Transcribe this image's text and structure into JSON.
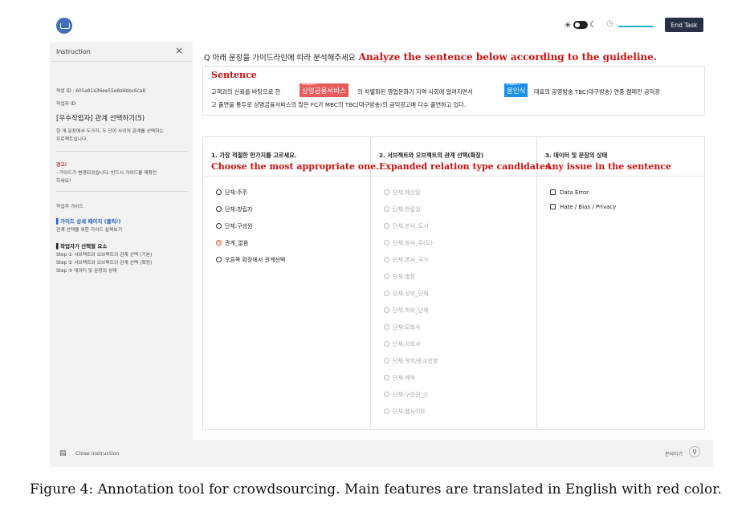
{
  "topbar": {
    "sun_icon": "sun-icon",
    "moon_icon": "moon-icon",
    "timer_icon": "timer-icon",
    "timer_color": "#18b4c8",
    "end_task": "End Task"
  },
  "sidebar": {
    "title": "Instruction",
    "close_glyph": "×",
    "task_id": "작업 ID : 605a91e36ee55e8d6bbc6ca8",
    "worker_id": "작업자 ID",
    "task_title": "[우수작업자] 관계 선택하기(5)",
    "desc_line1": "한 개 문장에서 두가지, 두 단어 사이의 관계를 선택하는",
    "desc_line2": "프로젝트입니다.",
    "warning_title": "경고!",
    "warning_line1": "- 가이드가 변경되었습니다. 반드시 가이드를 재확인",
    "warning_line2": "하세요!",
    "guide_heading": "작업자 가이드",
    "guide_link": "▌가이드 상세 페이지 (클릭!)",
    "guide_sub": "관계 선택을 위한 가이드 살펴보기",
    "required_heading": "▌작업자가 선택할 요소",
    "steps": [
      "Step ① 서브젝트와 오브젝트의 관계 선택 (기본)",
      "Step ② 서브젝트와 오브젝트의 관계 선택 (확장)",
      "Step ③ 데이터 및 문장의 상태"
    ]
  },
  "question": {
    "ko": "Q 아래 문장을 가이드라인에 따라 분석해주세요",
    "en": "Analyze the sentence below according to the guideline."
  },
  "sentence": {
    "label": "Sentence",
    "line1_a": "고객과의 신뢰를 바탕으로 한",
    "subject_tag": "SUBJECT",
    "subject": "상명금융서비스",
    "line1_b": "의 차별화된 영업문화가 지역 사회에 알려지면서",
    "object_tag": "OBJECT",
    "object": "윤인식",
    "line1_c": "대표의 공영방송 TBC(대구방송) 연중 캠페인 공익광",
    "line2": "고 출연을 통두로 상명금융서비스의 많은 FC가 MBC의 TBC(대구방송)의 공익광고에 다수 출연하고 있다."
  },
  "panels": {
    "p1": {
      "heading": "1. 가장 적절한 한가지를 고르세요.",
      "en": "Choose the most appropriate one.",
      "options": [
        "단체:주주",
        "단체:창립자",
        "단체:구성원",
        "관계_없음",
        "오른쪽 확장에서 관계선택"
      ],
      "selected_index": 3
    },
    "p2": {
      "heading": "2. 서브젝트와 오브젝트의 관계 선택(확장)",
      "en": "Expanded relation type candidates",
      "options": [
        "단체:해산일",
        "단체:창립일",
        "단체:본사_도시",
        "단체:본사_주(도)",
        "단체:본사_국가",
        "단체:별칭",
        "단체:상위_단체",
        "단체:하위_단체",
        "단체:모회사",
        "단체:자회사",
        "단체:정치/종교성향",
        "단체:제작",
        "단체:구성원_수",
        "단체:웹사이트"
      ]
    },
    "p3": {
      "heading": "3. 데이터 및 문장의 상태",
      "en": "Any issue in the sentence",
      "options": [
        "Data Error",
        "Hate / Bias / Privacy"
      ]
    }
  },
  "footer": {
    "menu_icon": "menu-icon",
    "close_instruction": "Close Instruction",
    "right_label": "분석하기",
    "search_icon": "search-icon"
  },
  "caption": "Figure 4: Annotation tool for crowdsourcing. Main features are translated in English with red color.",
  "colors": {
    "translation_red": "#cc1111",
    "subject_bg": "#e85b5b",
    "object_bg": "#1a8fe8",
    "button_dark": "#273046",
    "sidebar_bg": "#f2f2f2"
  }
}
